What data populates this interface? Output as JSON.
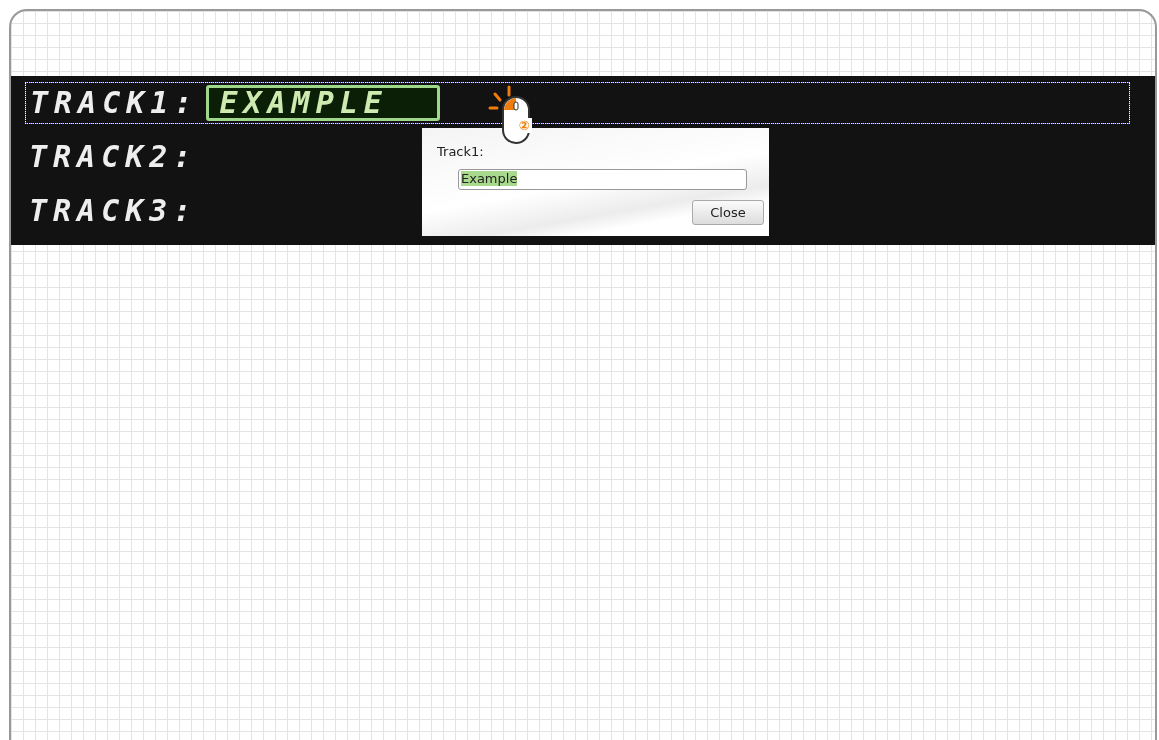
{
  "tracks": [
    {
      "label": "TRACK1:",
      "value": "EXAMPLE",
      "selected": true
    },
    {
      "label": "TRACK2:",
      "selected": false
    },
    {
      "label": "TRACK3:",
      "selected": false
    }
  ],
  "dialog": {
    "label": "Track1:",
    "value": "Example",
    "value_selected": true,
    "button": "Close"
  },
  "step_badge": "②"
}
